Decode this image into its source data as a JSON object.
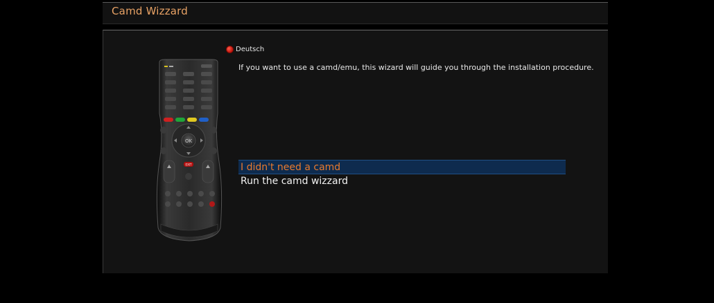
{
  "window": {
    "title": "Camd Wizzard"
  },
  "language": {
    "label": "Deutsch",
    "button_color": "#d11a0c"
  },
  "description": "If you want to use a camd/emu, this wizard will guide you through the installation procedure.",
  "choices": [
    {
      "label": "I didn't need a camd",
      "selected": true
    },
    {
      "label": "Run the camd wizzard",
      "selected": false
    }
  ],
  "remote": {
    "icon": "remote-control-icon",
    "ok_label": "OK",
    "exit_label": "EXIT"
  },
  "colors": {
    "title": "#e8a265",
    "selection_bg": "#0e2b4e",
    "selection_text": "#e87a2e"
  }
}
